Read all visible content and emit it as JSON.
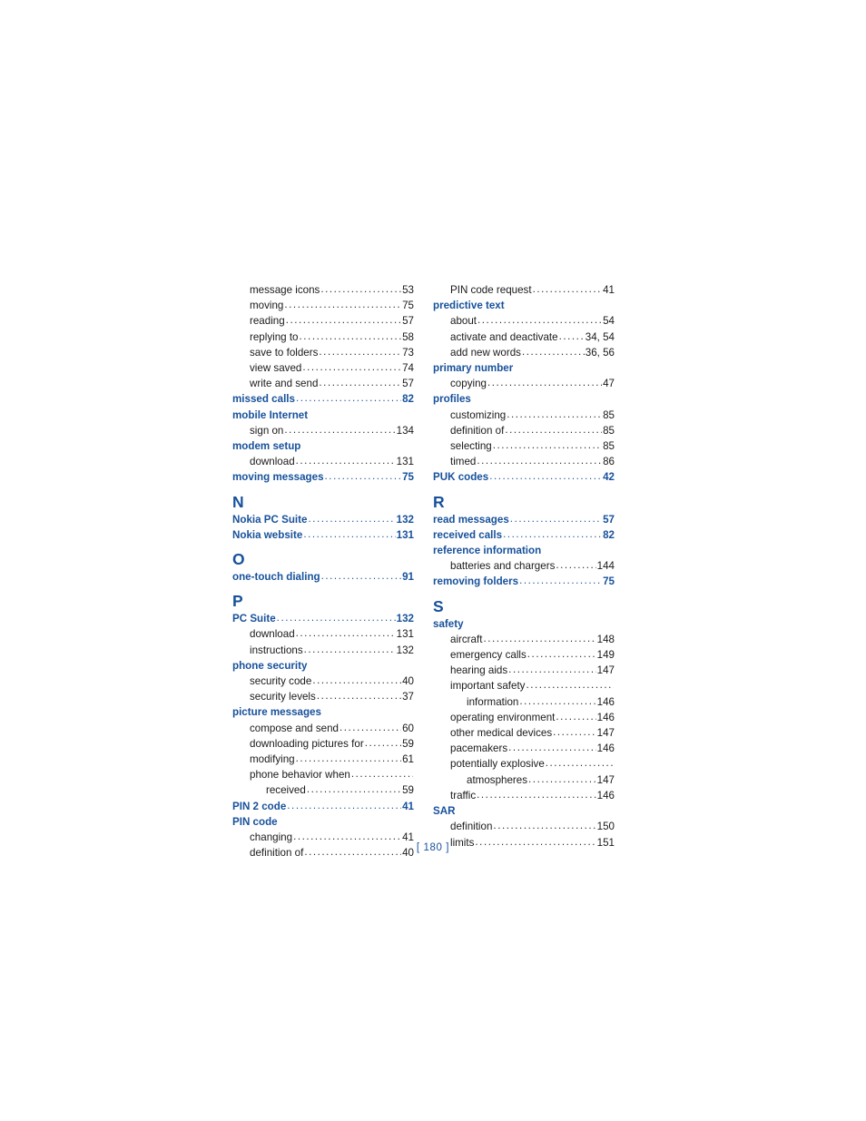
{
  "document": {
    "page_label": "[ 180 ]",
    "accent_color": "#17519b",
    "text_color": "#1a1a1a"
  },
  "index": {
    "left_column": [
      {
        "type": "entry",
        "level": 1,
        "style": "sub",
        "label": "message icons",
        "pages": "53"
      },
      {
        "type": "entry",
        "level": 1,
        "style": "sub",
        "label": "moving",
        "pages": "75"
      },
      {
        "type": "entry",
        "level": 1,
        "style": "sub",
        "label": "reading",
        "pages": "57"
      },
      {
        "type": "entry",
        "level": 1,
        "style": "sub",
        "label": "replying to",
        "pages": "58"
      },
      {
        "type": "entry",
        "level": 1,
        "style": "sub",
        "label": "save to folders",
        "pages": "73"
      },
      {
        "type": "entry",
        "level": 1,
        "style": "sub",
        "label": "view saved",
        "pages": "74"
      },
      {
        "type": "entry",
        "level": 1,
        "style": "sub",
        "label": "write and send",
        "pages": "57"
      },
      {
        "type": "entry",
        "level": 0,
        "style": "head",
        "label": "missed calls",
        "pages": "82"
      },
      {
        "type": "entry",
        "level": 0,
        "style": "head",
        "label": "mobile Internet",
        "pages": ""
      },
      {
        "type": "entry",
        "level": 1,
        "style": "sub",
        "label": "sign on",
        "pages": "134"
      },
      {
        "type": "entry",
        "level": 0,
        "style": "head",
        "label": "modem setup",
        "pages": ""
      },
      {
        "type": "entry",
        "level": 1,
        "style": "sub",
        "label": "download",
        "pages": "131"
      },
      {
        "type": "entry",
        "level": 0,
        "style": "head",
        "label": "moving messages",
        "pages": "75"
      },
      {
        "type": "letter",
        "label": "N"
      },
      {
        "type": "entry",
        "level": 0,
        "style": "head",
        "label": "Nokia PC Suite",
        "pages": "132"
      },
      {
        "type": "entry",
        "level": 0,
        "style": "head",
        "label": "Nokia website",
        "pages": "131"
      },
      {
        "type": "letter",
        "label": "O"
      },
      {
        "type": "entry",
        "level": 0,
        "style": "head",
        "label": "one-touch dialing",
        "pages": "91"
      },
      {
        "type": "letter",
        "label": "P"
      },
      {
        "type": "entry",
        "level": 0,
        "style": "head",
        "label": "PC Suite",
        "pages": "132"
      },
      {
        "type": "entry",
        "level": 1,
        "style": "sub",
        "label": "download",
        "pages": "131"
      },
      {
        "type": "entry",
        "level": 1,
        "style": "sub",
        "label": "instructions",
        "pages": "132"
      },
      {
        "type": "entry",
        "level": 0,
        "style": "head",
        "label": "phone security",
        "pages": ""
      },
      {
        "type": "entry",
        "level": 1,
        "style": "sub",
        "label": "security code",
        "pages": "40"
      },
      {
        "type": "entry",
        "level": 1,
        "style": "sub",
        "label": "security levels",
        "pages": "37"
      },
      {
        "type": "entry",
        "level": 0,
        "style": "head",
        "label": "picture messages",
        "pages": ""
      },
      {
        "type": "entry",
        "level": 1,
        "style": "sub",
        "label": "compose and send",
        "pages": "60"
      },
      {
        "type": "entry",
        "level": 1,
        "style": "sub",
        "label": "downloading pictures for",
        "pages": "59"
      },
      {
        "type": "entry",
        "level": 1,
        "style": "sub",
        "label": "modifying",
        "pages": "61"
      },
      {
        "type": "entry",
        "level": 1,
        "style": "sub",
        "label": "phone behavior when",
        "pages": ""
      },
      {
        "type": "entry",
        "level": 2,
        "style": "sub",
        "label": "received",
        "pages": "59"
      },
      {
        "type": "entry",
        "level": 0,
        "style": "head",
        "label": "PIN 2 code",
        "pages": "41"
      },
      {
        "type": "entry",
        "level": 0,
        "style": "head",
        "label": "PIN code",
        "pages": ""
      },
      {
        "type": "entry",
        "level": 1,
        "style": "sub",
        "label": "changing",
        "pages": "41"
      },
      {
        "type": "entry",
        "level": 1,
        "style": "sub",
        "label": "definition of",
        "pages": "40"
      }
    ],
    "right_column": [
      {
        "type": "entry",
        "level": 1,
        "style": "sub",
        "label": "PIN code request",
        "pages": "41"
      },
      {
        "type": "entry",
        "level": 0,
        "style": "head",
        "label": "predictive text",
        "pages": ""
      },
      {
        "type": "entry",
        "level": 1,
        "style": "sub",
        "label": "about",
        "pages": "54"
      },
      {
        "type": "entry",
        "level": 1,
        "style": "sub",
        "label": "activate and deactivate",
        "pages": "34, 54"
      },
      {
        "type": "entry",
        "level": 1,
        "style": "sub",
        "label": "add new words",
        "pages": "36, 56"
      },
      {
        "type": "entry",
        "level": 0,
        "style": "head",
        "label": "primary number",
        "pages": ""
      },
      {
        "type": "entry",
        "level": 1,
        "style": "sub",
        "label": "copying",
        "pages": "47"
      },
      {
        "type": "entry",
        "level": 0,
        "style": "head",
        "label": "profiles",
        "pages": ""
      },
      {
        "type": "entry",
        "level": 1,
        "style": "sub",
        "label": "customizing",
        "pages": "85"
      },
      {
        "type": "entry",
        "level": 1,
        "style": "sub",
        "label": "definition of",
        "pages": "85"
      },
      {
        "type": "entry",
        "level": 1,
        "style": "sub",
        "label": "selecting",
        "pages": "85"
      },
      {
        "type": "entry",
        "level": 1,
        "style": "sub",
        "label": "timed",
        "pages": "86"
      },
      {
        "type": "entry",
        "level": 0,
        "style": "head",
        "label": "PUK codes",
        "pages": "42"
      },
      {
        "type": "letter",
        "label": "R"
      },
      {
        "type": "entry",
        "level": 0,
        "style": "head",
        "label": "read messages",
        "pages": "57"
      },
      {
        "type": "entry",
        "level": 0,
        "style": "head",
        "label": "received calls",
        "pages": "82"
      },
      {
        "type": "entry",
        "level": 0,
        "style": "head",
        "label": "reference information",
        "pages": ""
      },
      {
        "type": "entry",
        "level": 1,
        "style": "sub",
        "label": "batteries and chargers",
        "pages": "144"
      },
      {
        "type": "entry",
        "level": 0,
        "style": "head",
        "label": "removing folders",
        "pages": "75"
      },
      {
        "type": "letter",
        "label": "S"
      },
      {
        "type": "entry",
        "level": 0,
        "style": "head",
        "label": "safety",
        "pages": ""
      },
      {
        "type": "entry",
        "level": 1,
        "style": "sub",
        "label": "aircraft",
        "pages": "148"
      },
      {
        "type": "entry",
        "level": 1,
        "style": "sub",
        "label": "emergency calls",
        "pages": "149"
      },
      {
        "type": "entry",
        "level": 1,
        "style": "sub",
        "label": "hearing aids",
        "pages": "147"
      },
      {
        "type": "entry",
        "level": 1,
        "style": "sub",
        "label": "important safety",
        "pages": ""
      },
      {
        "type": "entry",
        "level": 2,
        "style": "sub",
        "label": "information",
        "pages": "146"
      },
      {
        "type": "entry",
        "level": 1,
        "style": "sub",
        "label": "operating environment",
        "pages": "146"
      },
      {
        "type": "entry",
        "level": 1,
        "style": "sub",
        "label": "other medical devices",
        "pages": "147"
      },
      {
        "type": "entry",
        "level": 1,
        "style": "sub",
        "label": "pacemakers",
        "pages": "146"
      },
      {
        "type": "entry",
        "level": 1,
        "style": "sub",
        "label": "potentially explosive",
        "pages": ""
      },
      {
        "type": "entry",
        "level": 2,
        "style": "sub",
        "label": "atmospheres",
        "pages": "147"
      },
      {
        "type": "entry",
        "level": 1,
        "style": "sub",
        "label": "traffic",
        "pages": "146"
      },
      {
        "type": "entry",
        "level": 0,
        "style": "head",
        "label": "SAR",
        "pages": ""
      },
      {
        "type": "entry",
        "level": 1,
        "style": "sub",
        "label": "definition",
        "pages": "150"
      },
      {
        "type": "entry",
        "level": 1,
        "style": "sub",
        "label": "limits",
        "pages": "151"
      }
    ]
  }
}
